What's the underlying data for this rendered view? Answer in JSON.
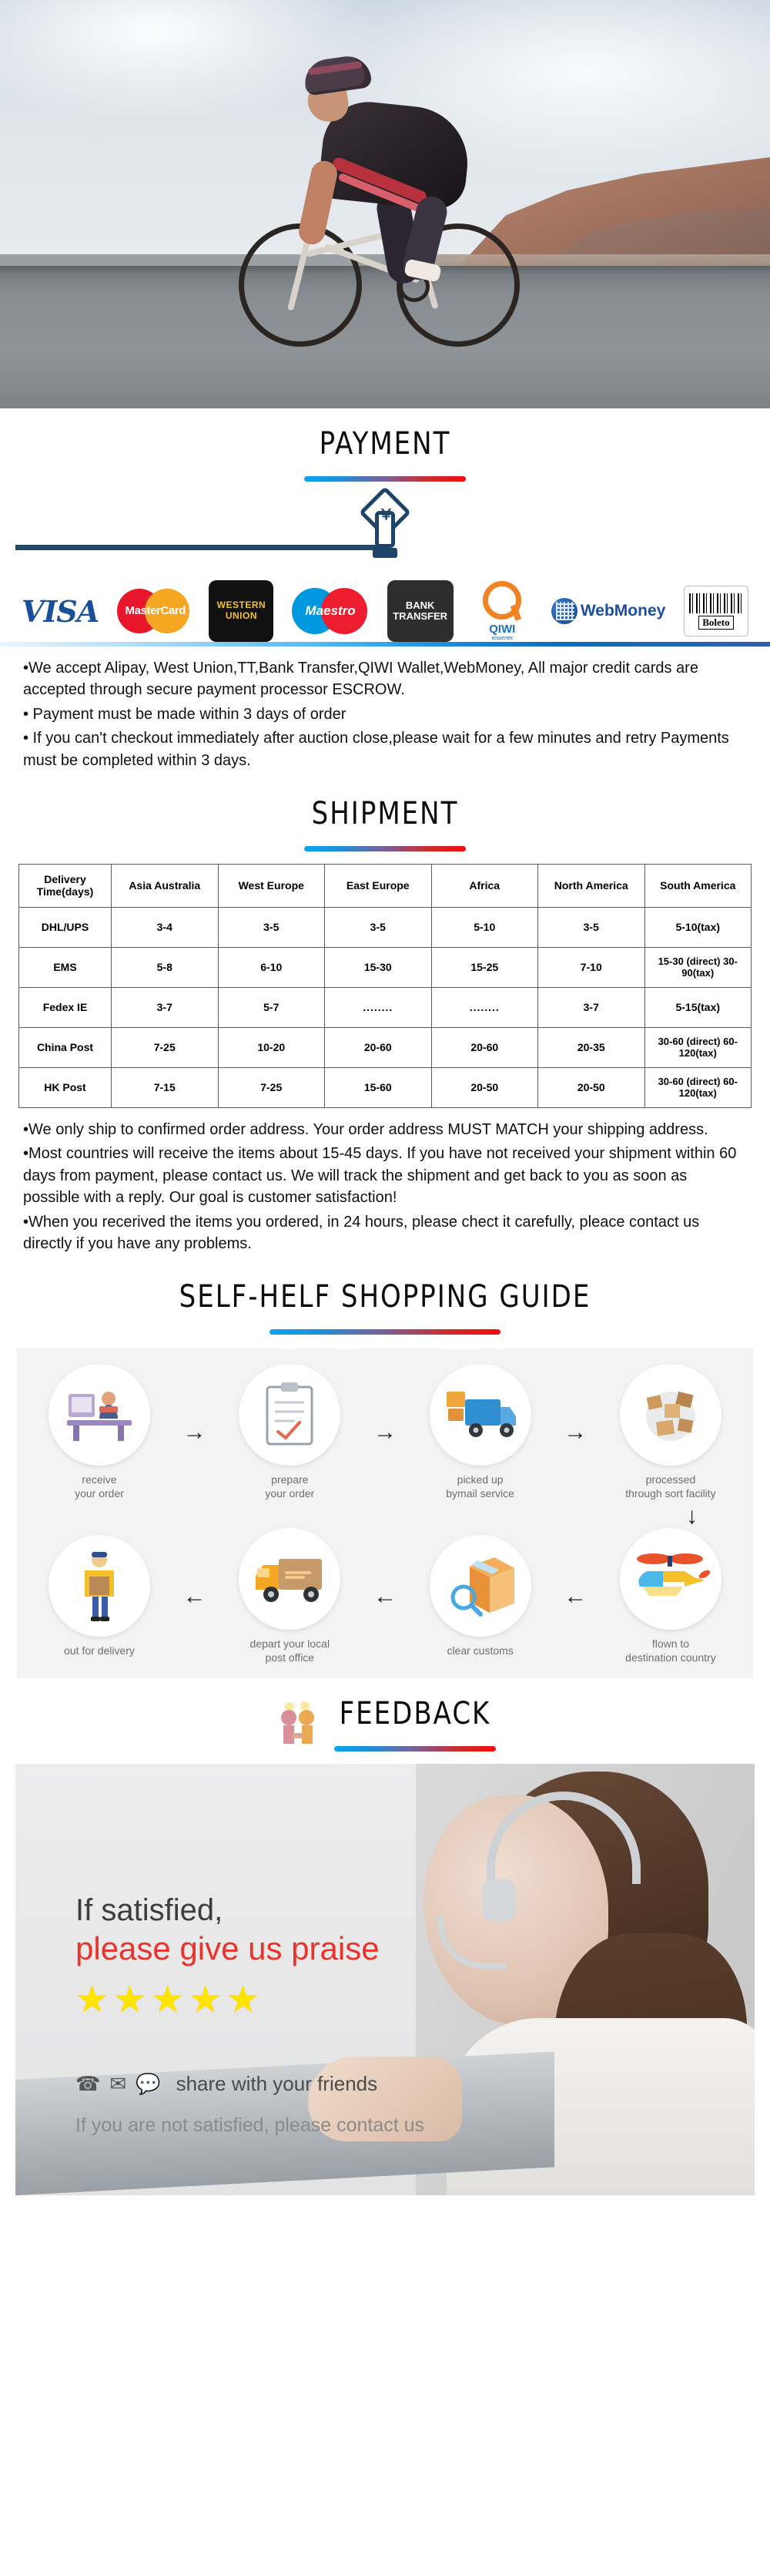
{
  "hero": {
    "alt": "cyclist riding road bike on mountain road at sunset"
  },
  "payment": {
    "title": "PAYMENT",
    "logos": [
      {
        "name": "visa-logo",
        "label": "VISA"
      },
      {
        "name": "mastercard-logo",
        "label": "MasterCard"
      },
      {
        "name": "western-union-logo",
        "line1": "WESTERN",
        "line2": "UNION"
      },
      {
        "name": "maestro-logo",
        "label": "Maestro"
      },
      {
        "name": "bank-transfer-logo",
        "line1": "BANK",
        "line2": "TRANSFER"
      },
      {
        "name": "qiwi-logo",
        "label": "QIWI",
        "sub": "кошелёк"
      },
      {
        "name": "webmoney-logo",
        "label": "WebMoney"
      },
      {
        "name": "boleto-logo",
        "label": "Boleto"
      }
    ],
    "paragraphs": [
      "•We accept Alipay, West Union,TT,Bank Transfer,QIWI Wallet,WebMoney, All major credit cards are accepted through secure payment processor ESCROW.",
      "• Payment must be made within 3 days of order",
      "• If you can't checkout immediately after auction close,please wait for a few minutes and retry Payments must be completed within 3 days."
    ]
  },
  "shipment": {
    "title": "SHIPMENT",
    "table": {
      "headers": [
        "Delivery Time(days)",
        "Asia Australia",
        "West Europe",
        "East Europe",
        "Africa",
        "North America",
        "South America"
      ],
      "rows": [
        {
          "method": "DHL/UPS",
          "cells": [
            "3-4",
            "3-5",
            "3-5",
            "5-10",
            "3-5",
            "5-10(tax)"
          ]
        },
        {
          "method": "EMS",
          "cells": [
            "5-8",
            "6-10",
            "15-30",
            "15-25",
            "7-10",
            "15-30 (direct) 30-90(tax)"
          ]
        },
        {
          "method": "Fedex IE",
          "cells": [
            "3-7",
            "5-7",
            "........",
            "........",
            "3-7",
            "5-15(tax)"
          ]
        },
        {
          "method": "China Post",
          "cells": [
            "7-25",
            "10-20",
            "20-60",
            "20-60",
            "20-35",
            "30-60 (direct) 60-120(tax)"
          ]
        },
        {
          "method": "HK Post",
          "cells": [
            "7-15",
            "7-25",
            "15-60",
            "20-50",
            "20-50",
            "30-60 (direct) 60-120(tax)"
          ]
        }
      ]
    },
    "paragraphs": [
      "•We only ship to confirmed order address. Your order address MUST MATCH your shipping address.",
      "•Most countries will receive the items about 15-45 days. If you have not received your shipment within 60 days from payment, please contact us. We will track the shipment and get back to you as soon as possible with a reply. Our goal is customer satisfaction!",
      "•When you recerived the items you ordered, in 24 hours, please chect it carefully, pleace contact us directly if you have any problems."
    ]
  },
  "guide": {
    "title": "SELF-HELF SHOPPING GUIDE",
    "row1": [
      {
        "icon": "order-desk-icon",
        "label": "receive\nyour order"
      },
      {
        "icon": "clipboard-icon",
        "label": "prepare\nyour order"
      },
      {
        "icon": "delivery-truck-icon",
        "label": "picked up\nbymail service"
      },
      {
        "icon": "parcels-globe-icon",
        "label": "processed\nthrough sort facility"
      }
    ],
    "row2": [
      {
        "icon": "courier-icon",
        "label": "out for delivery"
      },
      {
        "icon": "post-van-icon",
        "label": "depart your local\npost office"
      },
      {
        "icon": "customs-box-icon",
        "label": "clear customs"
      },
      {
        "icon": "helicopter-icon",
        "label": "flown to\ndestination country"
      }
    ],
    "arrow_right": "→",
    "arrow_left": "←",
    "arrow_down": "↓"
  },
  "feedback": {
    "title": "FEEDBACK",
    "handshake_icon": "handshake-icon",
    "line1": "If satisfied,",
    "line2": "please give us praise",
    "stars": 5,
    "star_glyph": "★",
    "share_text": "share with your friends",
    "share_icons": [
      "phone-icon",
      "email-icon",
      "chat-icon"
    ],
    "bottom_text": "If you are not satisfied, please contact us"
  },
  "colors": {
    "accent_blue": "#0aa3ef",
    "accent_red": "#f40b0b",
    "star_yellow": "#ffe400",
    "praise_red": "#e8342c"
  }
}
